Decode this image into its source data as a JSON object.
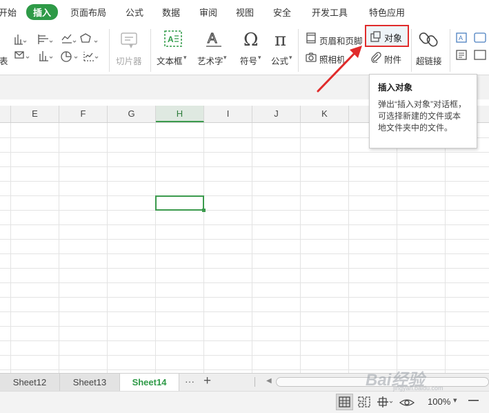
{
  "menu": {
    "items": [
      "开始",
      "插入",
      "页面布局",
      "公式",
      "数据",
      "审阅",
      "视图",
      "安全",
      "开发工具",
      "特色应用"
    ],
    "active": "插入"
  },
  "ribbon": {
    "left_partial_label": "表",
    "slicer_label": "切片器",
    "textbox_label": "文本框",
    "wordart_label": "艺术字",
    "symbol_label": "符号",
    "formula_label": "公式",
    "header_footer_label": "页眉和页脚",
    "object_label": "对象",
    "camera_label": "照相机",
    "attachment_label": "附件",
    "hyperlink_label": "超链接"
  },
  "tooltip": {
    "title": "插入对象",
    "body": "弹出“插入对象”对话框，可选择新建的文件或本地文件夹中的文件。"
  },
  "columns": [
    "E",
    "F",
    "G",
    "H",
    "I",
    "J",
    "K"
  ],
  "selected_column": "H",
  "sheets": [
    "Sheet12",
    "Sheet13",
    "Sheet14"
  ],
  "active_sheet": "Sheet14",
  "tabbar": {
    "more_label": "···",
    "add_label": "+"
  },
  "status": {
    "zoom": "100%",
    "zoom_dropdown": "▾",
    "minus": "—"
  },
  "watermark": {
    "text": "Bai经验",
    "sub": "jingyan.baidu.com"
  },
  "colors": {
    "accent_green": "#2e9a47",
    "annotation_red": "#e02b2b"
  }
}
